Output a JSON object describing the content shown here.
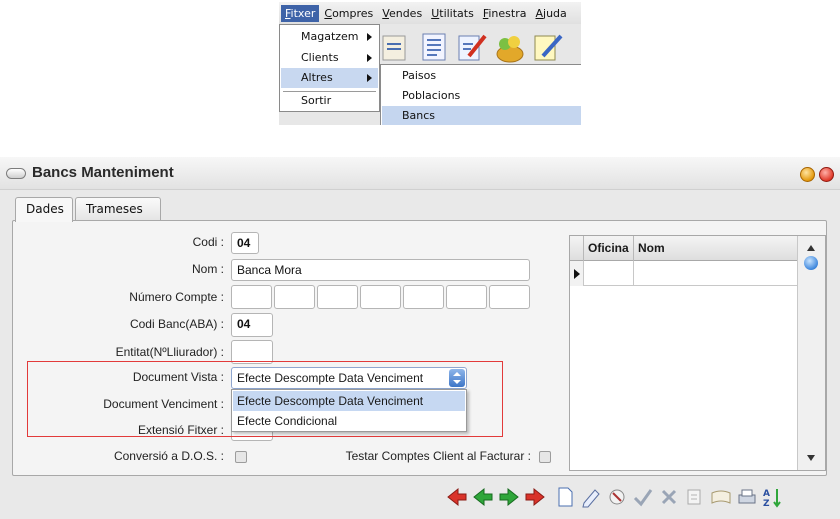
{
  "menubar": {
    "items": [
      "Fitxer",
      "Compres",
      "Vendes",
      "Utilitats",
      "Finestra",
      "Ajuda"
    ],
    "active": "Fitxer"
  },
  "fitxer_menu": {
    "items": [
      "Magatzem",
      "Clients",
      "Altres",
      "Sortir"
    ],
    "highlighted": "Altres"
  },
  "altres_submenu": {
    "items": [
      "Paisos",
      "Poblacions",
      "Bancs"
    ],
    "highlighted": "Bancs"
  },
  "window": {
    "title": "Bancs Manteniment"
  },
  "tabs": [
    "Dades",
    "Trameses"
  ],
  "form": {
    "labels": {
      "codi": "Codi :",
      "nom": "Nom :",
      "numero_compte": "Número Compte :",
      "codi_banc": "Codi Banc(ABA) :",
      "entitat": "Entitat(NºLliurador) :",
      "document_vista": "Document Vista :",
      "document_venciment": "Document Venciment :",
      "extensio_fitxer": "Extensió Fitxer :",
      "conversio_dos": "Conversió a D.O.S. :",
      "testar_comptes": "Testar Comptes Client al Facturar :"
    },
    "values": {
      "codi": "04",
      "nom": "Banca Mora",
      "codi_banc": "04",
      "document_vista": "Efecte Descompte Data Venciment"
    },
    "document_vista_options": [
      "Efecte Descompte Data Venciment",
      "Efecte Condicional"
    ],
    "document_vista_highlighted": "Efecte Descompte Data Venciment"
  },
  "grid": {
    "columns": [
      "Oficina",
      "Nom"
    ]
  }
}
